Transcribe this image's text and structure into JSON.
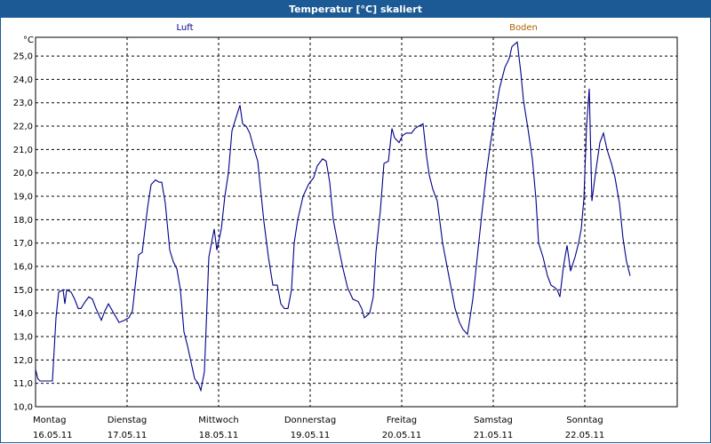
{
  "window": {
    "title": "Temperatur [°C] skaliert"
  },
  "colors": {
    "luft": "#00008b",
    "boden": "#b36200",
    "grid": "#000000",
    "titlebar": "#1b5a94"
  },
  "chart_data": {
    "type": "line",
    "title": "Temperatur [°C] skaliert",
    "ylabel": "°C",
    "ylim": [
      10.0,
      25.8
    ],
    "yticks": [
      "11,0",
      "12,0",
      "13,0",
      "14,0",
      "15,0",
      "16,0",
      "17,0",
      "18,0",
      "19,0",
      "20,0",
      "21,0",
      "22,0",
      "23,0",
      "24,0",
      "25,0"
    ],
    "grid": true,
    "legend": [
      "Luft",
      "Boden"
    ],
    "x_days": [
      {
        "day": "Montag",
        "date": "16.05.11"
      },
      {
        "day": "Dienstag",
        "date": "17.05.11"
      },
      {
        "day": "Mittwoch",
        "date": "18.05.11"
      },
      {
        "day": "Donnerstag",
        "date": "19.05.11"
      },
      {
        "day": "Freitag",
        "date": "20.05.11"
      },
      {
        "day": "Samstag",
        "date": "21.05.11"
      },
      {
        "day": "Sonntag",
        "date": "22.05.11"
      }
    ],
    "series": [
      {
        "name": "Luft",
        "color": "#00008b",
        "points": [
          [
            0.0,
            11.6
          ],
          [
            0.024,
            11.2
          ],
          [
            0.049,
            11.1
          ],
          [
            0.146,
            11.1
          ],
          [
            0.184,
            11.1
          ],
          [
            0.223,
            13.8
          ],
          [
            0.252,
            14.9
          ],
          [
            0.301,
            15.0
          ],
          [
            0.32,
            14.4
          ],
          [
            0.34,
            15.0
          ],
          [
            0.388,
            14.9
          ],
          [
            0.427,
            14.6
          ],
          [
            0.466,
            14.2
          ],
          [
            0.495,
            14.2
          ],
          [
            0.544,
            14.5
          ],
          [
            0.583,
            14.7
          ],
          [
            0.621,
            14.6
          ],
          [
            0.66,
            14.2
          ],
          [
            0.718,
            13.7
          ],
          [
            0.757,
            14.1
          ],
          [
            0.796,
            14.4
          ],
          [
            0.854,
            14.0
          ],
          [
            0.913,
            13.6
          ],
          [
            0.971,
            13.7
          ],
          [
            1.019,
            13.8
          ],
          [
            1.058,
            14.1
          ],
          [
            1.126,
            16.5
          ],
          [
            1.165,
            16.6
          ],
          [
            1.223,
            18.5
          ],
          [
            1.262,
            19.5
          ],
          [
            1.311,
            19.7
          ],
          [
            1.35,
            19.6
          ],
          [
            1.379,
            19.6
          ],
          [
            1.417,
            18.7
          ],
          [
            1.466,
            16.7
          ],
          [
            1.505,
            16.2
          ],
          [
            1.544,
            15.9
          ],
          [
            1.583,
            15.0
          ],
          [
            1.621,
            13.2
          ],
          [
            1.66,
            12.6
          ],
          [
            1.699,
            11.9
          ],
          [
            1.738,
            11.2
          ],
          [
            1.777,
            11.0
          ],
          [
            1.806,
            10.7
          ],
          [
            1.845,
            11.5
          ],
          [
            1.893,
            16.4
          ],
          [
            1.951,
            17.6
          ],
          [
            1.981,
            16.7
          ],
          [
            2.029,
            17.6
          ],
          [
            2.068,
            19.0
          ],
          [
            2.107,
            20.0
          ],
          [
            2.146,
            21.8
          ],
          [
            2.184,
            22.3
          ],
          [
            2.233,
            22.9
          ],
          [
            2.262,
            22.1
          ],
          [
            2.301,
            22.0
          ],
          [
            2.34,
            21.7
          ],
          [
            2.388,
            21.0
          ],
          [
            2.427,
            20.5
          ],
          [
            2.466,
            19.0
          ],
          [
            2.495,
            17.9
          ],
          [
            2.544,
            16.4
          ],
          [
            2.592,
            15.2
          ],
          [
            2.641,
            15.2
          ],
          [
            2.68,
            14.4
          ],
          [
            2.718,
            14.2
          ],
          [
            2.757,
            14.2
          ],
          [
            2.796,
            15.0
          ],
          [
            2.825,
            17.0
          ],
          [
            2.864,
            18.0
          ],
          [
            2.922,
            19.0
          ],
          [
            2.981,
            19.5
          ],
          [
            3.039,
            19.8
          ],
          [
            3.078,
            20.3
          ],
          [
            3.136,
            20.6
          ],
          [
            3.175,
            20.5
          ],
          [
            3.214,
            19.6
          ],
          [
            3.252,
            18.0
          ],
          [
            3.301,
            17.0
          ],
          [
            3.359,
            15.9
          ],
          [
            3.408,
            15.1
          ],
          [
            3.466,
            14.6
          ],
          [
            3.524,
            14.5
          ],
          [
            3.563,
            14.2
          ],
          [
            3.592,
            13.8
          ],
          [
            3.65,
            14.0
          ],
          [
            3.689,
            14.7
          ],
          [
            3.718,
            16.6
          ],
          [
            3.767,
            18.4
          ],
          [
            3.806,
            20.4
          ],
          [
            3.854,
            20.5
          ],
          [
            3.893,
            21.9
          ],
          [
            3.922,
            21.5
          ],
          [
            3.971,
            21.3
          ],
          [
            4.01,
            21.6
          ],
          [
            4.049,
            21.7
          ],
          [
            4.107,
            21.7
          ],
          [
            4.146,
            21.9
          ],
          [
            4.184,
            22.0
          ],
          [
            4.233,
            22.1
          ],
          [
            4.272,
            20.7
          ],
          [
            4.301,
            19.9
          ],
          [
            4.34,
            19.3
          ],
          [
            4.388,
            18.8
          ],
          [
            4.447,
            17.0
          ],
          [
            4.505,
            15.8
          ],
          [
            4.544,
            15.0
          ],
          [
            4.583,
            14.2
          ],
          [
            4.631,
            13.6
          ],
          [
            4.67,
            13.3
          ],
          [
            4.718,
            13.1
          ],
          [
            4.777,
            14.6
          ],
          [
            4.825,
            16.4
          ],
          [
            4.874,
            18.2
          ],
          [
            4.922,
            19.9
          ],
          [
            4.971,
            21.3
          ],
          [
            5.029,
            22.7
          ],
          [
            5.068,
            23.6
          ],
          [
            5.126,
            24.5
          ],
          [
            5.175,
            24.9
          ],
          [
            5.204,
            25.4
          ],
          [
            5.233,
            25.5
          ],
          [
            5.262,
            25.6
          ],
          [
            5.301,
            24.3
          ],
          [
            5.33,
            23.1
          ],
          [
            5.379,
            21.9
          ],
          [
            5.427,
            20.6
          ],
          [
            5.466,
            18.9
          ],
          [
            5.495,
            17.0
          ],
          [
            5.544,
            16.4
          ],
          [
            5.592,
            15.6
          ],
          [
            5.631,
            15.2
          ],
          [
            5.67,
            15.1
          ],
          [
            5.699,
            15.0
          ],
          [
            5.728,
            14.7
          ],
          [
            5.767,
            16.0
          ],
          [
            5.806,
            16.9
          ],
          [
            5.845,
            15.8
          ],
          [
            5.893,
            16.4
          ],
          [
            5.932,
            17.0
          ],
          [
            5.961,
            17.6
          ],
          [
            5.99,
            18.9
          ],
          [
            6.019,
            22.0
          ],
          [
            6.049,
            23.6
          ],
          [
            6.078,
            18.8
          ],
          [
            6.117,
            20.0
          ],
          [
            6.165,
            21.3
          ],
          [
            6.204,
            21.7
          ],
          [
            6.243,
            21.0
          ],
          [
            6.291,
            20.4
          ],
          [
            6.33,
            19.8
          ],
          [
            6.379,
            18.7
          ],
          [
            6.417,
            17.2
          ],
          [
            6.456,
            16.2
          ],
          [
            6.495,
            15.6
          ]
        ]
      }
    ]
  }
}
